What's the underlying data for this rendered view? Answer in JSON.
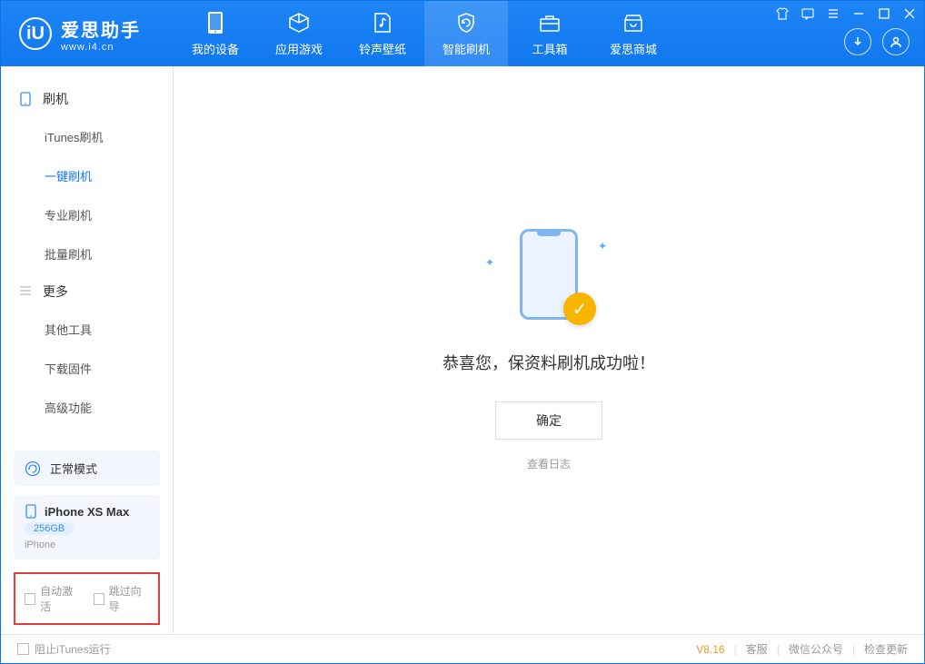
{
  "app": {
    "name": "爱思助手",
    "site": "www.i4.cn"
  },
  "tabs": [
    {
      "label": "我的设备"
    },
    {
      "label": "应用游戏"
    },
    {
      "label": "铃声壁纸"
    },
    {
      "label": "智能刷机"
    },
    {
      "label": "工具箱"
    },
    {
      "label": "爱思商城"
    }
  ],
  "sidebar": {
    "section1": {
      "title": "刷机",
      "items": [
        "iTunes刷机",
        "一键刷机",
        "专业刷机",
        "批量刷机"
      ]
    },
    "section2": {
      "title": "更多",
      "items": [
        "其他工具",
        "下载固件",
        "高级功能"
      ]
    }
  },
  "mode": {
    "label": "正常模式"
  },
  "device": {
    "name": "iPhone XS Max",
    "capacity": "256GB",
    "type": "iPhone"
  },
  "options": {
    "autoActivate": "自动激活",
    "skipGuide": "跳过向导"
  },
  "main": {
    "successText": "恭喜您，保资料刷机成功啦！",
    "okButton": "确定",
    "viewLog": "查看日志"
  },
  "statusbar": {
    "blockItunes": "阻止iTunes运行",
    "version": "V8.16",
    "links": [
      "客服",
      "微信公众号",
      "检查更新"
    ]
  }
}
